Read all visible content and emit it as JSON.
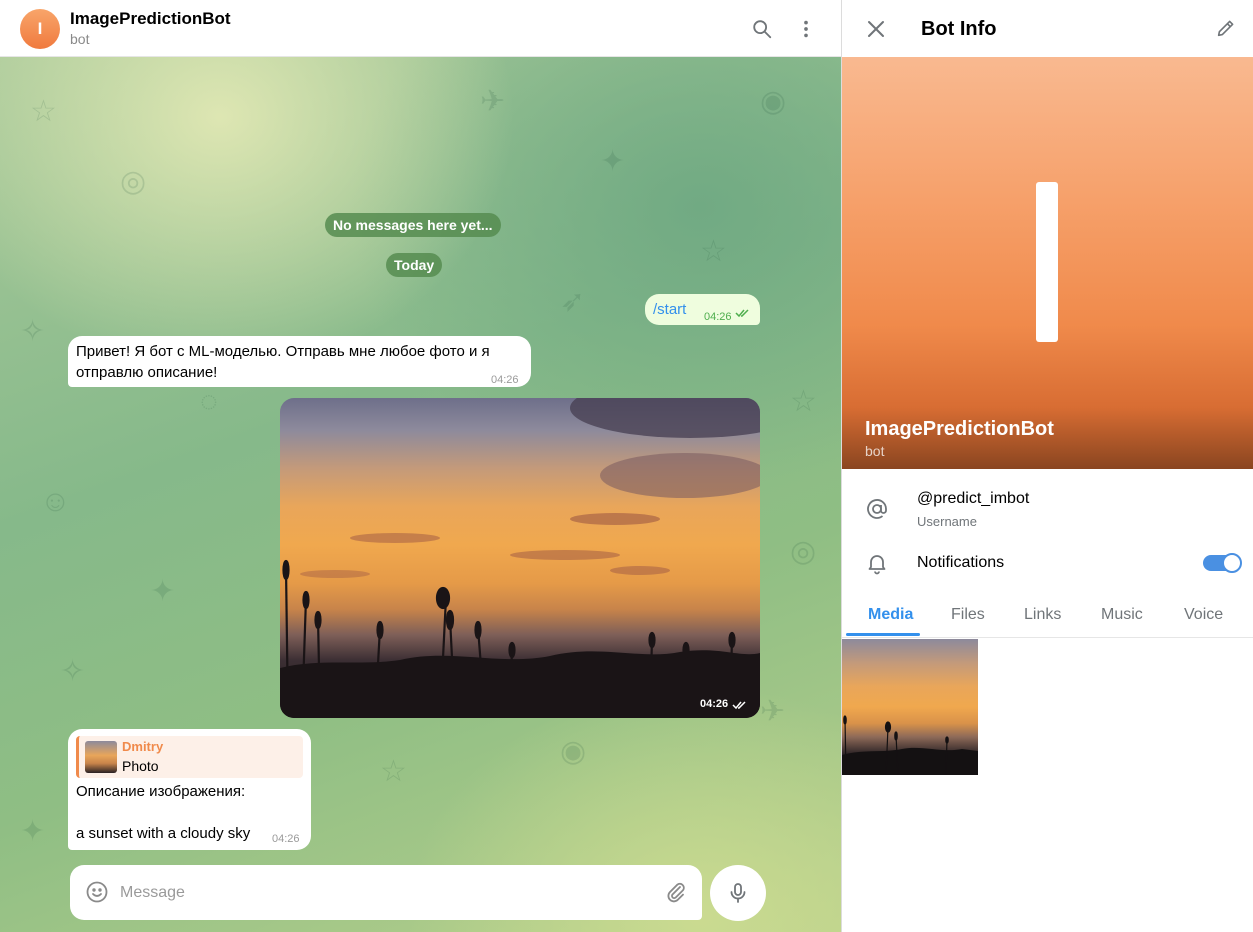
{
  "colors": {
    "accent": "#3390ec",
    "avatar": "#f08a4b",
    "outgoing_bubble": "#effdde",
    "incoming_bubble": "#ffffff",
    "service_pill": "#568c50"
  },
  "header": {
    "avatar_letter": "I",
    "title": "ImagePredictionBot",
    "subtitle": "bot",
    "icons": [
      "search-icon",
      "more-vertical-icon"
    ]
  },
  "service": {
    "empty_notice": "No messages here yet...",
    "date": "Today"
  },
  "messages": [
    {
      "direction": "out",
      "text": "/start",
      "time": "04:26",
      "status": "read"
    },
    {
      "direction": "in",
      "text": "Привет! Я бот с ML-моделью. Отправь мне любое фото и я отправлю описание!",
      "time": "04:26"
    },
    {
      "direction": "out",
      "type": "photo",
      "time": "04:26",
      "status": "read"
    },
    {
      "direction": "in",
      "reply_to": {
        "author": "Dmitry",
        "kind": "Photo"
      },
      "text_line1": "Описание изображения:",
      "text_line2": "a sunset with a cloudy sky",
      "time": "04:26"
    }
  ],
  "composer": {
    "placeholder": "Message",
    "value": "",
    "icons": [
      "emoji-icon",
      "attach-icon",
      "microphone-icon"
    ]
  },
  "info_panel": {
    "title": "Bot Info",
    "cover_name": "ImagePredictionBot",
    "cover_status": "bot",
    "username": "@predict_imbot",
    "username_label": "Username",
    "notifications_label": "Notifications",
    "notifications_enabled": true,
    "tabs": [
      "Media",
      "Files",
      "Links",
      "Music",
      "Voice"
    ],
    "active_tab": "Media"
  }
}
